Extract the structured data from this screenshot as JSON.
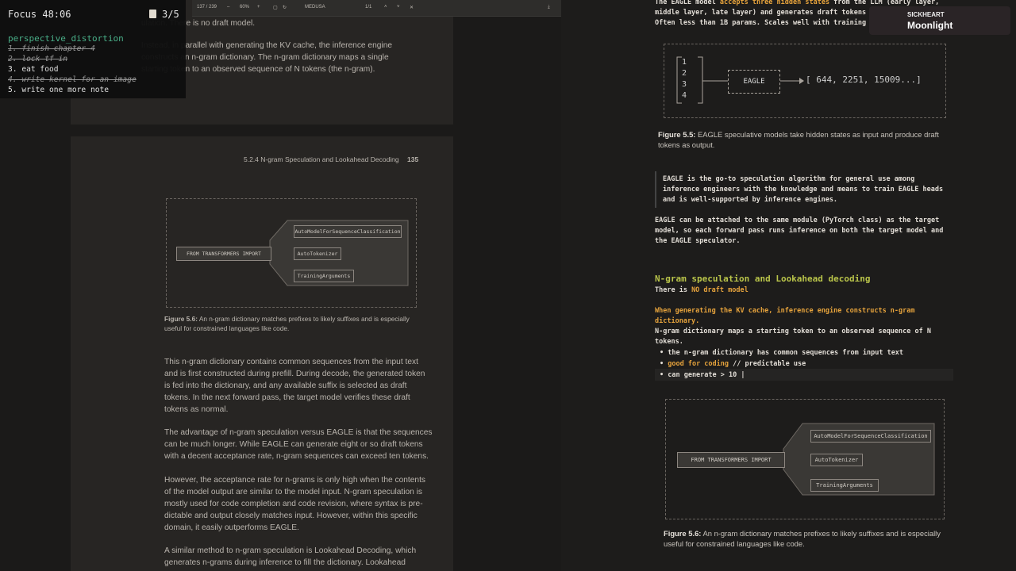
{
  "focus": {
    "title": "Focus 48:06",
    "count": "3/5",
    "list_title": "perspective_distortion",
    "todos": [
      {
        "text": "1. finish chapter 4",
        "done": true
      },
      {
        "text": "2. lock tf in",
        "done": true
      },
      {
        "text": "3. eat food",
        "done": false
      },
      {
        "text": "4. write kernel for an image",
        "done": true
      },
      {
        "text": "5. write one more note",
        "done": false
      }
    ]
  },
  "toolbar": {
    "page": "137 / 239",
    "zoom": "60%",
    "doc": "MEDUSA",
    "match": "1/1"
  },
  "pdf": {
    "top_text_1": "ulation. There is no draft model.",
    "top_para": [
      "Instead, in parallel with generating the KV cache, the inference engine",
      "constructs an n-gram dictionary. The n-gram dictionary maps a single",
      "starting token to an observed sequence of N tokens (the n-gram)."
    ],
    "header": "5.2.4   N-gram Speculation and Lookahead Decoding",
    "page_number": "135",
    "fig_import": "FROM TRANSFORMERS IMPORT",
    "fig_items": [
      "AutoModelForSequenceClassification",
      "AutoTokenizer",
      "TrainingArguments"
    ],
    "fig_caption_bold": "Figure 5.6:",
    "fig_caption": " An n-gram dictionary matches prefixes to likely suffixes and is especially useful for constrained languages like code.",
    "para1": [
      "This n-gram dictionary contains common sequences from the input text",
      "and is first constructed during prefill. During decode, the generated token",
      "is fed into the dictionary, and any available suffix is selected as draft",
      "tokens. In the next forward pass, the target model verifies these draft",
      "tokens as normal."
    ],
    "para2": [
      "The advantage of n-gram speculation versus EAGLE is that the sequences",
      "can be much longer. While EAGLE can generate eight or so draft tokens",
      "with a decent acceptance rate, n-gram sequences can exceed ten tokens."
    ],
    "para3": [
      "However, the acceptance rate for n-grams is only high when the contents",
      "of the model output are similar to the model input. N-gram speculation is",
      "mostly used for code completion and code revision, where syntax is pre-",
      "dictable and output closely matches input. However, within this specific",
      "domain, it easily outperforms EAGLE."
    ],
    "para4": [
      "A similar method to n-gram speculation is Lookahead Decoding, which",
      "generates n-grams during inference to fill the dictionary. Lookahead"
    ]
  },
  "spotify": {
    "artist": "SICKHEART",
    "track": "Moonlight"
  },
  "notes": {
    "top1_a": "The EAGLE model ",
    "top1_b": "accepts three hidden states",
    "top1_c": " from the LLM (early layer,",
    "top2": "middle layer, late layer) and generates draft tokens",
    "top3": "Often less than 1B params. Scales well with training",
    "eagle_nums": [
      "1",
      "2",
      "3",
      "4"
    ],
    "eagle_label": "EAGLE",
    "eagle_out": "[ 644, 2251, 15009...]",
    "fig55_bold": "Figure 5.5:",
    "fig55": " EAGLE speculative models take hidden states as input and produce draft tokens as output.",
    "quote": [
      "EAGLE is the go-to speculation algorithm for general use among",
      "inference engineers with the knowledge and means to train EAGLE heads",
      "and is well-supported by inference engines."
    ],
    "attach": [
      "EAGLE can be attached to the same module (PyTorch class) as the target",
      "model, so each forward pass runs inference on both the target model and",
      "the EAGLE speculator."
    ],
    "heading": "N-gram speculation and Lookahead decoding",
    "nodraft_a": "There is ",
    "nodraft_b": "NO draft model",
    "kv": [
      "When generating the KV cache, inference engine constructs n-gram",
      "dictionary."
    ],
    "maps": [
      "N-gram dictionary maps a starting token to an observed sequence of N",
      "tokens."
    ],
    "b1": "• the n-gram dictionary has common sequences from input text",
    "b2a": "• ",
    "b2b": "good for coding",
    "b2c": " // predictable use",
    "b3": "• can generate > 10 |",
    "fig_import": "FROM TRANSFORMERS IMPORT",
    "fig_items": [
      "AutoModelForSequenceClassification",
      "AutoTokenizer",
      "TrainingArguments"
    ],
    "fig56_bold": "Figure 5.6:",
    "fig56": " An n-gram dictionary matches prefixes to likely suffixes and is especially useful for constrained languages like code."
  }
}
